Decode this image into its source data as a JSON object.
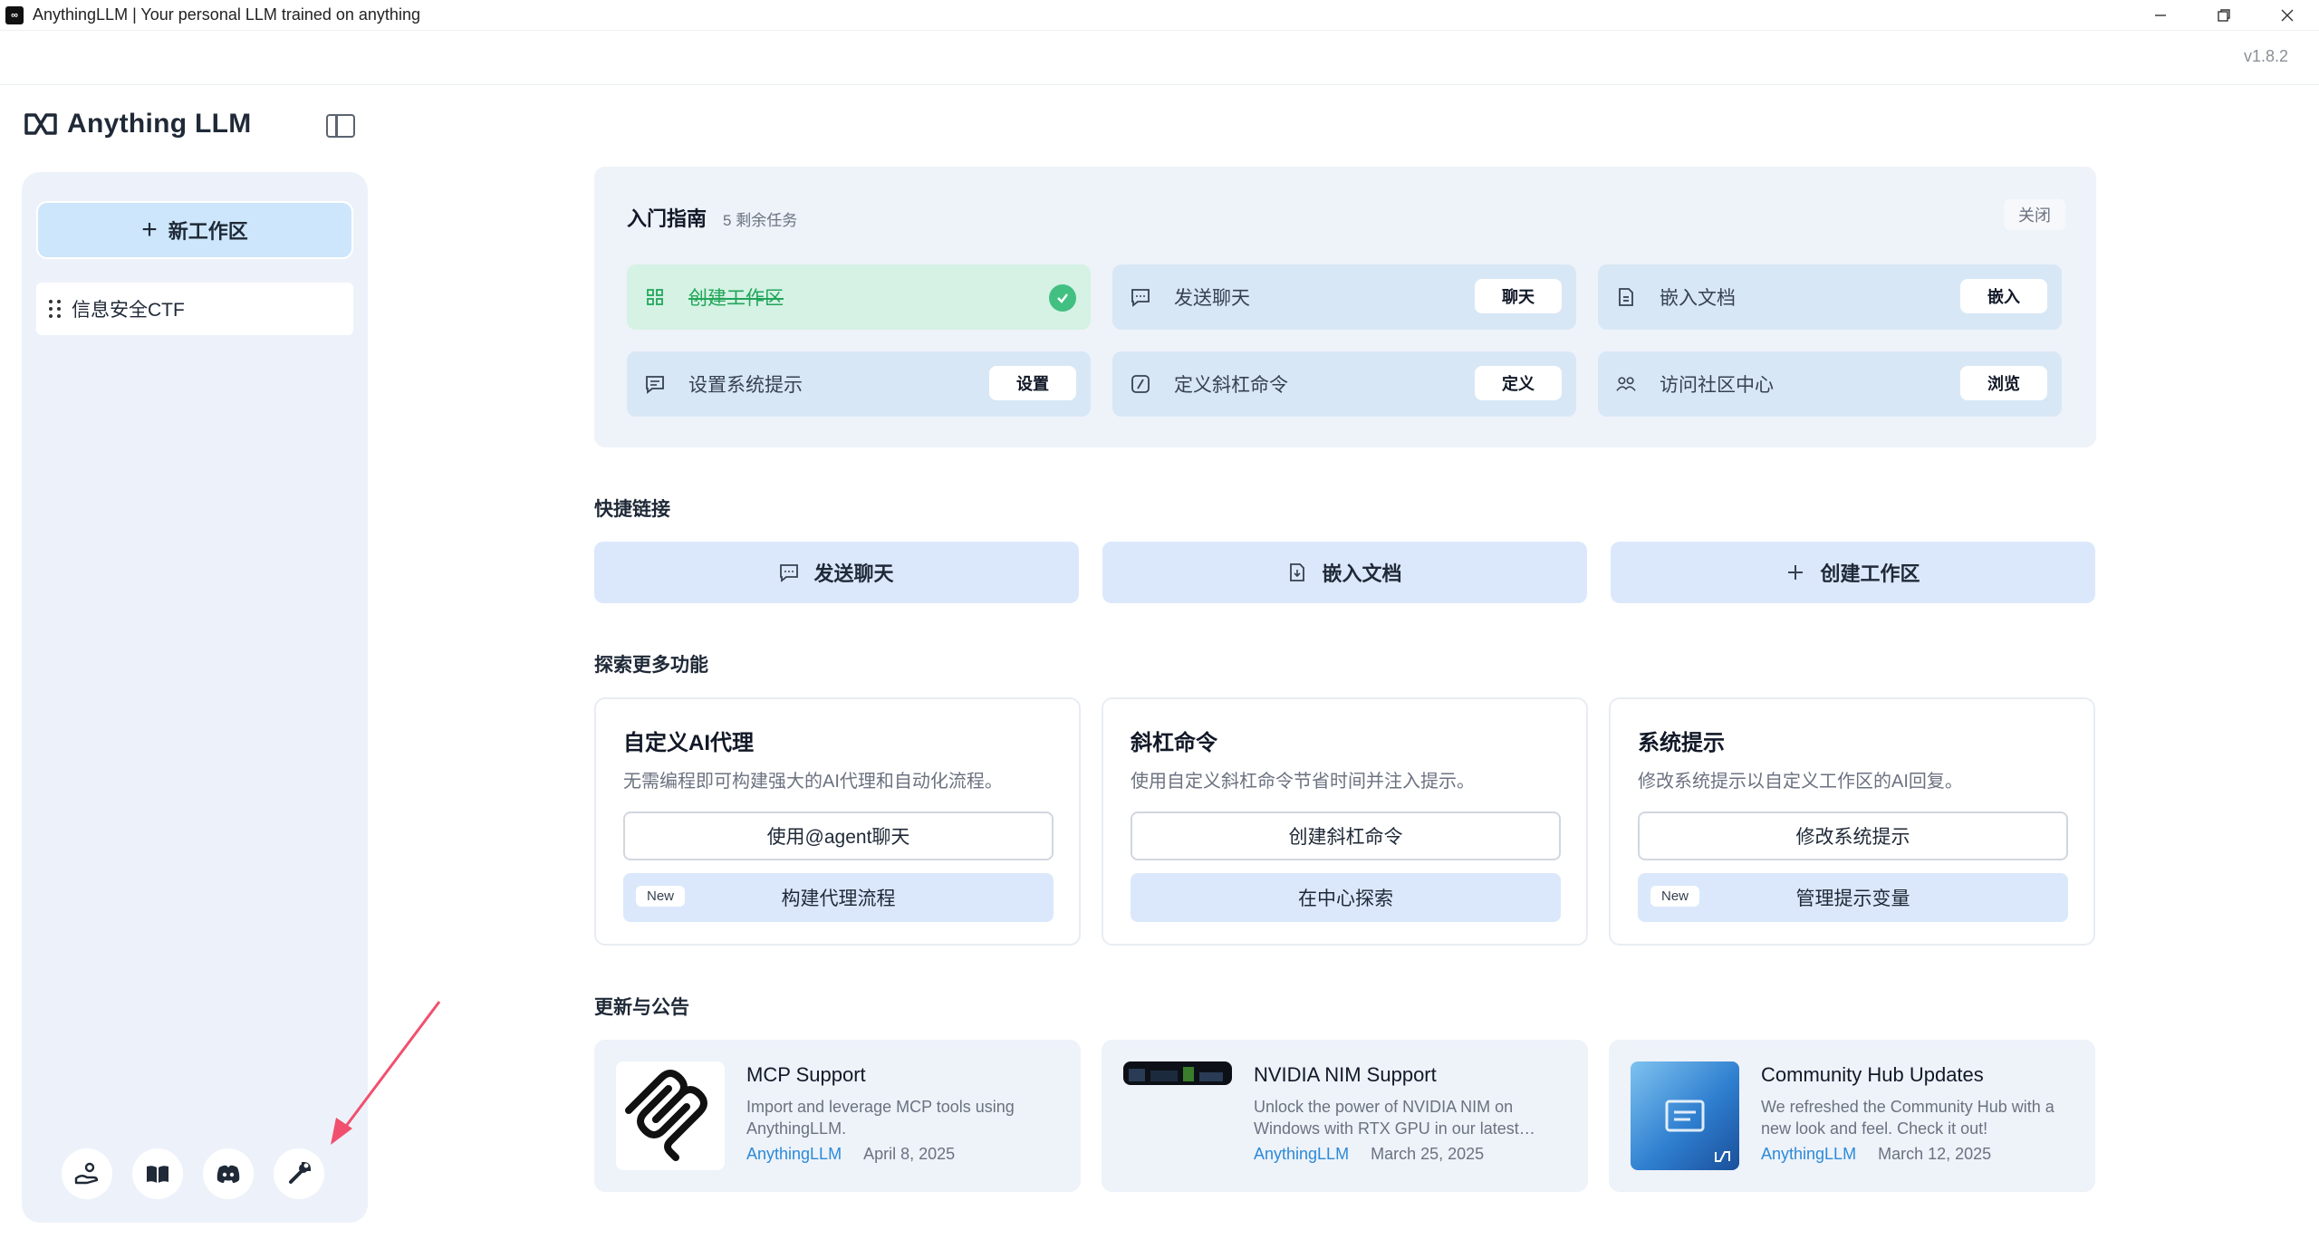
{
  "window": {
    "title": "AnythingLLM | Your personal LLM trained on anything",
    "app_icon": "anythingllm-logo",
    "controls": [
      "minimize",
      "restore",
      "close"
    ]
  },
  "appbar": {
    "version": "v1.8.2"
  },
  "brand": {
    "logo_text": "Anything LLM"
  },
  "sidebar": {
    "new_workspace_label": "新工作区",
    "workspaces": [
      {
        "name": "信息安全CTF"
      }
    ],
    "footer_icons": [
      "community-hub-icon",
      "docs-book-icon",
      "discord-icon",
      "settings-wrench-icon"
    ]
  },
  "guide": {
    "title": "入门指南",
    "remaining": "5 剩余任务",
    "close_label": "关闭",
    "tasks": [
      {
        "label": "创建工作区",
        "done": true,
        "icon": "grid-icon"
      },
      {
        "label": "发送聊天",
        "action": "聊天",
        "icon": "chat-icon"
      },
      {
        "label": "嵌入文档",
        "action": "嵌入",
        "icon": "document-icon"
      },
      {
        "label": "设置系统提示",
        "action": "设置",
        "icon": "message-icon"
      },
      {
        "label": "定义斜杠命令",
        "action": "定义",
        "icon": "slash-icon"
      },
      {
        "label": "访问社区中心",
        "action": "浏览",
        "icon": "community-icon"
      }
    ]
  },
  "quick_links": {
    "title": "快捷链接",
    "items": [
      {
        "label": "发送聊天",
        "icon": "chat-icon"
      },
      {
        "label": "嵌入文档",
        "icon": "document-icon"
      },
      {
        "label": "创建工作区",
        "icon": "plus-icon"
      }
    ]
  },
  "explore": {
    "title": "探索更多功能",
    "cards": [
      {
        "title": "自定义AI代理",
        "desc": "无需编程即可构建强大的AI代理和自动化流程。",
        "primary": "使用@agent聊天",
        "secondary": "构建代理流程",
        "badge": "New"
      },
      {
        "title": "斜杠命令",
        "desc": "使用自定义斜杠命令节省时间并注入提示。",
        "primary": "创建斜杠命令",
        "secondary": "在中心探索",
        "badge": ""
      },
      {
        "title": "系统提示",
        "desc": "修改系统提示以自定义工作区的AI回复。",
        "primary": "修改系统提示",
        "secondary": "管理提示变量",
        "badge": "New"
      }
    ]
  },
  "news": {
    "title": "更新与公告",
    "items": [
      {
        "title": "MCP Support",
        "desc": "Import and leverage MCP tools using AnythingLLM.",
        "author": "AnythingLLM",
        "date": "April 8, 2025"
      },
      {
        "title": "NVIDIA NIM Support",
        "desc": "Unlock the power of NVIDIA NIM on Windows with RTX GPU in our latest…",
        "author": "AnythingLLM",
        "date": "March 25, 2025"
      },
      {
        "title": "Community Hub Updates",
        "desc": "We refreshed the Community Hub with a new look and feel. Check it out!",
        "author": "AnythingLLM",
        "date": "March 12, 2025"
      }
    ]
  },
  "colors": {
    "accent_blue": "#cde6fb",
    "task_bg": "#d7e7f5",
    "task_done_bg": "#d5f2e4",
    "done_green": "#42c082",
    "link_blue": "#2b8ad8",
    "annotation_arrow": "#f0506e"
  }
}
